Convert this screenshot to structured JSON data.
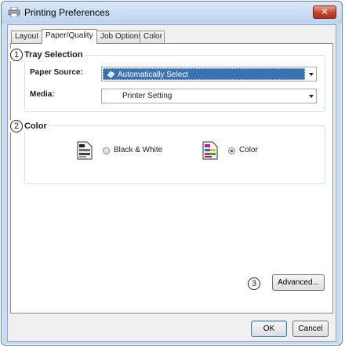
{
  "window": {
    "title": "Printing Preferences",
    "close_glyph": "✕"
  },
  "tabs": [
    {
      "label": "Layout",
      "active": false
    },
    {
      "label": "Paper/Quality",
      "active": true
    },
    {
      "label": "Job Options",
      "active": false
    },
    {
      "label": "Color",
      "active": false
    }
  ],
  "tray_selection": {
    "marker": "1",
    "title": "Tray Selection",
    "paper_source_label": "Paper Source:",
    "paper_source_value": "Automatically Select",
    "media_label": "Media:",
    "media_value": "Printer Setting"
  },
  "color_group": {
    "marker": "2",
    "title": "Color",
    "bw_label": "Black & White",
    "bw_selected": false,
    "color_label": "Color",
    "color_selected": true
  },
  "advanced": {
    "marker": "3",
    "label": "Advanced..."
  },
  "footer": {
    "ok_label": "OK",
    "cancel_label": "Cancel"
  },
  "colors": {
    "selection": "#3b72b5",
    "frame": "#c9dcf0",
    "close": "#c8442b"
  },
  "icons": [
    "printer-icon",
    "close-icon",
    "tray-icon",
    "monochrome-document-icon",
    "color-document-icon",
    "dropdown-arrow-icon"
  ]
}
